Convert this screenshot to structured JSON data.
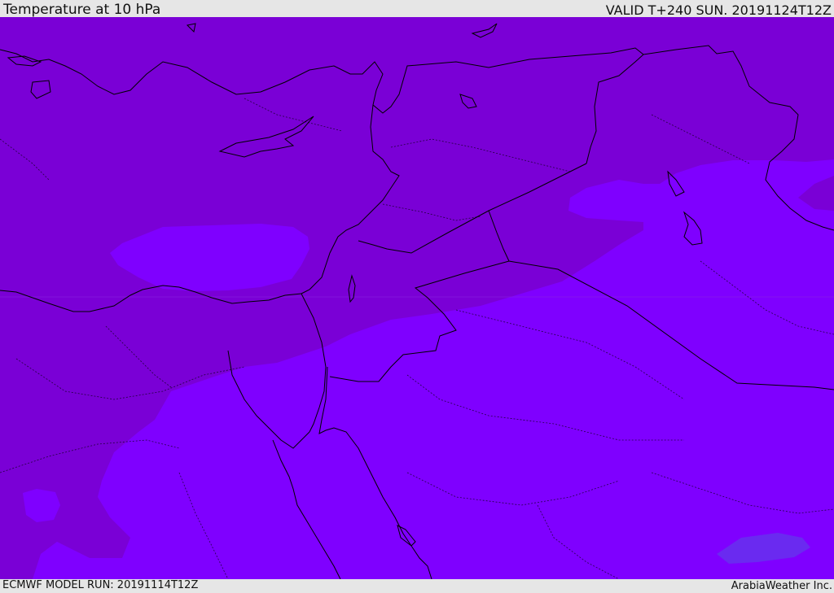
{
  "header": {
    "title": "Temperature at 10 hPa",
    "valid": "VALID T+240 SUN. 20191124T12Z"
  },
  "footer": {
    "model_run": "ECMWF MODEL RUN: 20191114T12Z",
    "brand": "ArabiaWeather Inc."
  },
  "colors": {
    "field_cold": "#7a00d6",
    "field_warm": "#7f00ff",
    "field_warmest": "#6a2af0",
    "coast": "#000000",
    "frame": "#e6e6e6"
  },
  "icons": {
    "map_field": "temperature-field-shading"
  }
}
